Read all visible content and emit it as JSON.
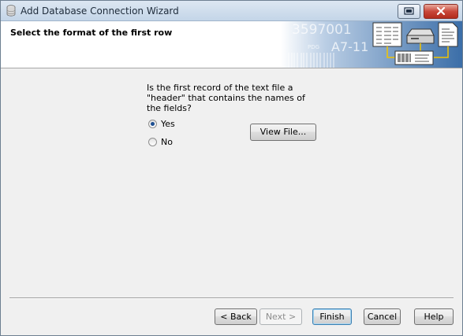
{
  "window": {
    "title": "Add Database Connection Wizard"
  },
  "header": {
    "title": "Select the format of the first row",
    "art_numbers": [
      "3597001",
      "A7-11",
      "PDG"
    ]
  },
  "question": {
    "text": "Is the first record of the text file a \"header\" that contains the names of the fields?"
  },
  "options": [
    {
      "label": "Yes",
      "selected": true
    },
    {
      "label": "No",
      "selected": false
    }
  ],
  "buttons": {
    "view_file": "View File...",
    "back": "< Back",
    "next": "Next >",
    "finish": "Finish",
    "cancel": "Cancel",
    "help": "Help"
  },
  "colors": {
    "title_bar": "#c4d5e8",
    "close_button": "#c9473a",
    "header_art": "#3b6ea8"
  }
}
